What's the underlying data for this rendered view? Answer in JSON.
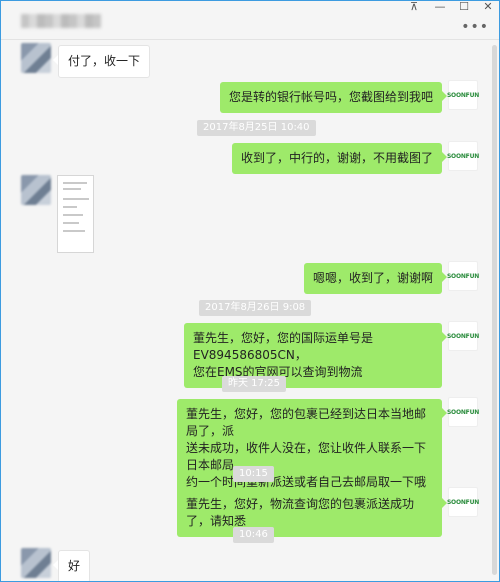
{
  "window": {
    "controls": {
      "pin": "⊼",
      "minimize": "—",
      "maximize": "☐",
      "close": "✕"
    },
    "more_icon": "•••"
  },
  "brand": {
    "avatar_text": "SOONFUN",
    "color": "#2a8c3c"
  },
  "colors": {
    "outgoing_bubble": "#9eea6a",
    "incoming_bubble": "#ffffff",
    "timestamp_bg": "#dadada"
  },
  "messages": [
    {
      "side": "left",
      "text": "付了，收一下"
    },
    {
      "side": "right",
      "text": "您是转的银行帐号吗，您截图给到我吧"
    },
    {
      "type": "time",
      "text": "2017年8月25日 10:40"
    },
    {
      "side": "right",
      "text": "收到了，中行的，谢谢，不用截图了"
    },
    {
      "side": "left",
      "type": "image"
    },
    {
      "side": "right",
      "text": "嗯嗯，收到了，谢谢啊"
    },
    {
      "type": "time",
      "text": "2017年8月26日 9:08"
    },
    {
      "side": "right",
      "lines": [
        "董先生，您好，您的国际运单号是EV894586805CN，",
        "您在EMS的官网可以查询到物流"
      ]
    },
    {
      "type": "time",
      "text": "昨天 17:25"
    },
    {
      "side": "right",
      "lines": [
        "董先生，您好，您的包裹已经到达日本当地邮局了，派",
        "送未成功，收件人没在，您让收件人联系一下日本邮局",
        "约一个时间重新派送或者自己去邮局取一下哦"
      ]
    },
    {
      "type": "time",
      "text": "10:15"
    },
    {
      "side": "right",
      "text": "董先生，您好，物流查询您的包裹派送成功了，请知悉"
    },
    {
      "type": "time",
      "text": "10:46"
    },
    {
      "side": "left",
      "text": "好"
    }
  ]
}
